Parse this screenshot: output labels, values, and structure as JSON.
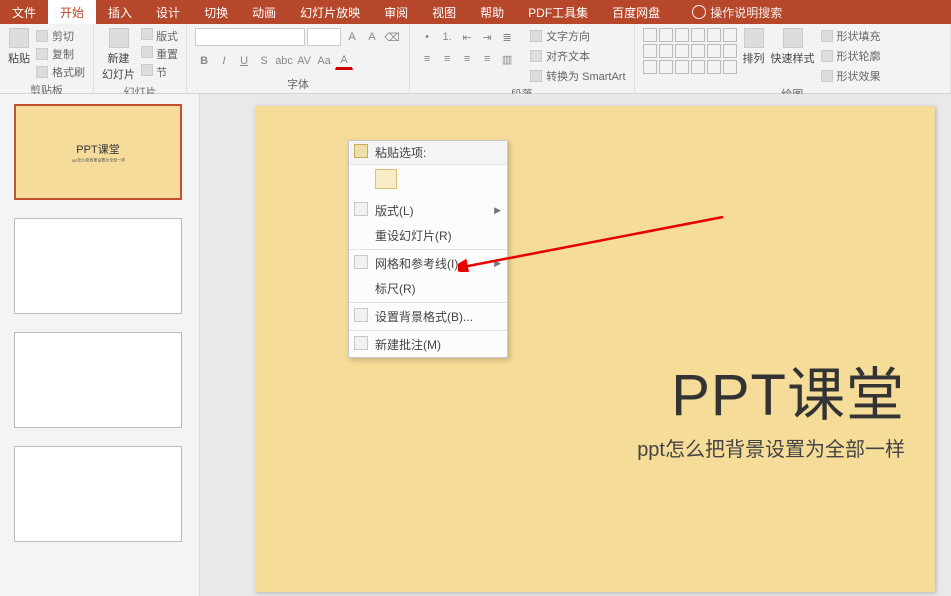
{
  "tabs": {
    "file": "文件",
    "home": "开始",
    "insert": "插入",
    "design": "设计",
    "transitions": "切换",
    "animations": "动画",
    "slideshow": "幻灯片放映",
    "review": "审阅",
    "view": "视图",
    "help": "帮助",
    "pdf": "PDF工具集",
    "baidu": "百度网盘",
    "tell": "操作说明搜索"
  },
  "ribbon": {
    "clipboard": {
      "label": "剪贴板",
      "paste": "粘贴",
      "cut": "剪切",
      "copy": "复制",
      "painter": "格式刷"
    },
    "slides": {
      "label": "幻灯片",
      "new": "新建\n幻灯片",
      "layout": "版式",
      "reset": "重置",
      "section": "节"
    },
    "font": {
      "label": "字体"
    },
    "paragraph": {
      "label": "段落",
      "textdir": "文字方向",
      "align": "对齐文本",
      "smartart": "转换为 SmartArt"
    },
    "drawing": {
      "label": "绘图",
      "arrange": "排列",
      "quickstyle": "快速样式",
      "fill": "形状填充",
      "outline": "形状轮廓",
      "effects": "形状效果"
    }
  },
  "slide": {
    "title": "PPT课堂",
    "subtitle": "ppt怎么把背景设置为全部一样"
  },
  "thumbs": {
    "slide1_title": "PPT课堂",
    "slide1_sub": "ppt怎么把背景设置为全部一样"
  },
  "context_menu": {
    "paste_header": "粘贴选项:",
    "layout": "版式(L)",
    "reset": "重设幻灯片(R)",
    "grid": "网格和参考线(I)...",
    "ruler": "标尺(R)",
    "bgformat": "设置背景格式(B)...",
    "comment": "新建批注(M)"
  }
}
